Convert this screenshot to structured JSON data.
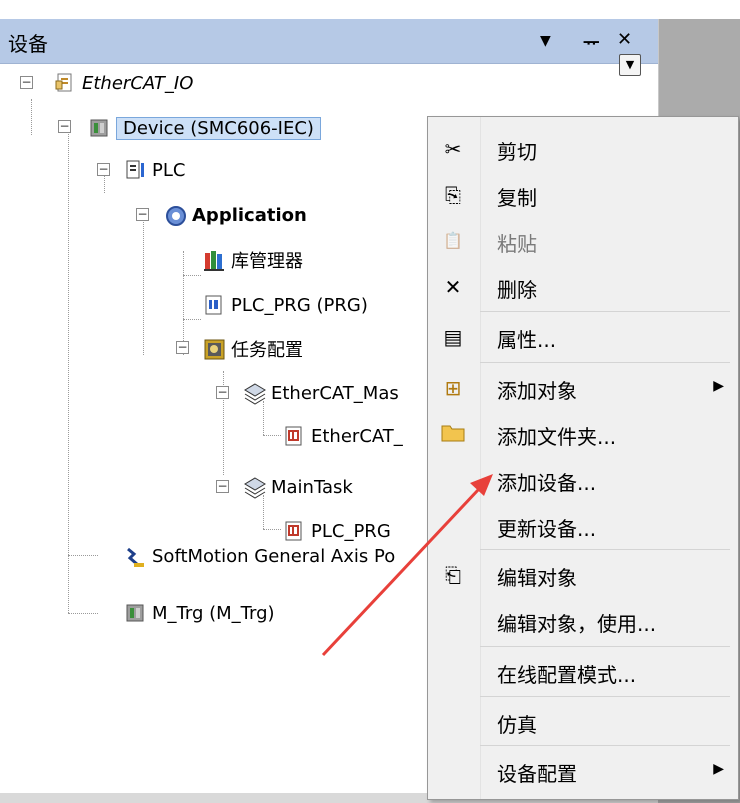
{
  "pane": {
    "title": "设备",
    "buttons": {
      "dropdown": "▼",
      "pin": "ᅲ",
      "close": "✕"
    }
  },
  "tree": {
    "root": "EtherCAT_IO",
    "device": "Device (SMC606-IEC)",
    "plc": "PLC",
    "application": "Application",
    "library_manager": "库管理器",
    "plc_prg": "PLC_PRG (PRG)",
    "task_config": "任务配置",
    "ethercat_master": "EtherCAT_Mas",
    "ethercat_call": "EtherCAT_",
    "main_task": "MainTask",
    "plc_prg_call": "PLC_PRG",
    "softmotion_axis": "SoftMotion General Axis Po",
    "m_trg": "M_Trg (M_Trg)"
  },
  "context_menu": {
    "items": [
      {
        "label": "剪切",
        "icon": "scissors-icon",
        "glyph": "✂",
        "enabled": true
      },
      {
        "label": "复制",
        "icon": "copy-icon",
        "glyph": "⎘",
        "enabled": true
      },
      {
        "label": "粘贴",
        "icon": "paste-icon",
        "glyph": "📋",
        "enabled": false
      },
      {
        "label": "删除",
        "icon": "delete-icon",
        "glyph": "✕",
        "enabled": true
      },
      {
        "label": "属性...",
        "icon": "properties-icon",
        "glyph": "▤",
        "enabled": true
      },
      {
        "label": "添加对象",
        "icon": "add-object-icon",
        "glyph": "⊞",
        "enabled": true,
        "submenu": true
      },
      {
        "label": "添加文件夹...",
        "icon": "folder-icon",
        "glyph": "",
        "enabled": true
      },
      {
        "label": "添加设备...",
        "icon": "",
        "glyph": "",
        "enabled": true
      },
      {
        "label": "更新设备...",
        "icon": "",
        "glyph": "",
        "enabled": true
      },
      {
        "label": "编辑对象",
        "icon": "edit-object-icon",
        "glyph": "⎗",
        "enabled": true
      },
      {
        "label": "编辑对象，使用...",
        "icon": "",
        "glyph": "",
        "enabled": true
      },
      {
        "label": "在线配置模式...",
        "icon": "",
        "glyph": "",
        "enabled": true
      },
      {
        "label": "仿真",
        "icon": "",
        "glyph": "",
        "enabled": true
      },
      {
        "label": "设备配置",
        "icon": "",
        "glyph": "",
        "enabled": true,
        "submenu": true
      }
    ]
  },
  "colors": {
    "titlebar": "#b6c9e6",
    "selection": "#cde0f7",
    "menu_bg": "#f0f0f0",
    "annotation_arrow": "#e8403a"
  }
}
